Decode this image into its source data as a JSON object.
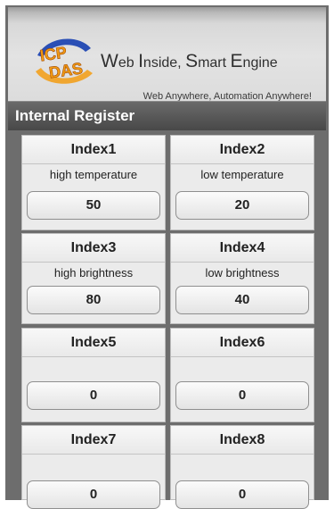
{
  "header": {
    "brand": "ICP DAS",
    "slogan": [
      "W",
      "eb ",
      "I",
      "nside, ",
      "S",
      "mart ",
      "E",
      "ngine"
    ],
    "tagline": "Web Anywhere, Automation Anywhere!",
    "colors": {
      "logo_blue": "#2a4fb5",
      "logo_orange": "#f39c12"
    }
  },
  "section": {
    "title": "Internal Register"
  },
  "registers": [
    {
      "index": "Index1",
      "label": "high temperature",
      "value": "50"
    },
    {
      "index": "Index2",
      "label": "low temperature",
      "value": "20"
    },
    {
      "index": "Index3",
      "label": "high brightness",
      "value": "80"
    },
    {
      "index": "Index4",
      "label": "low brightness",
      "value": "40"
    },
    {
      "index": "Index5",
      "label": "",
      "value": "0"
    },
    {
      "index": "Index6",
      "label": "",
      "value": "0"
    },
    {
      "index": "Index7",
      "label": "",
      "value": "0"
    },
    {
      "index": "Index8",
      "label": "",
      "value": "0"
    }
  ]
}
